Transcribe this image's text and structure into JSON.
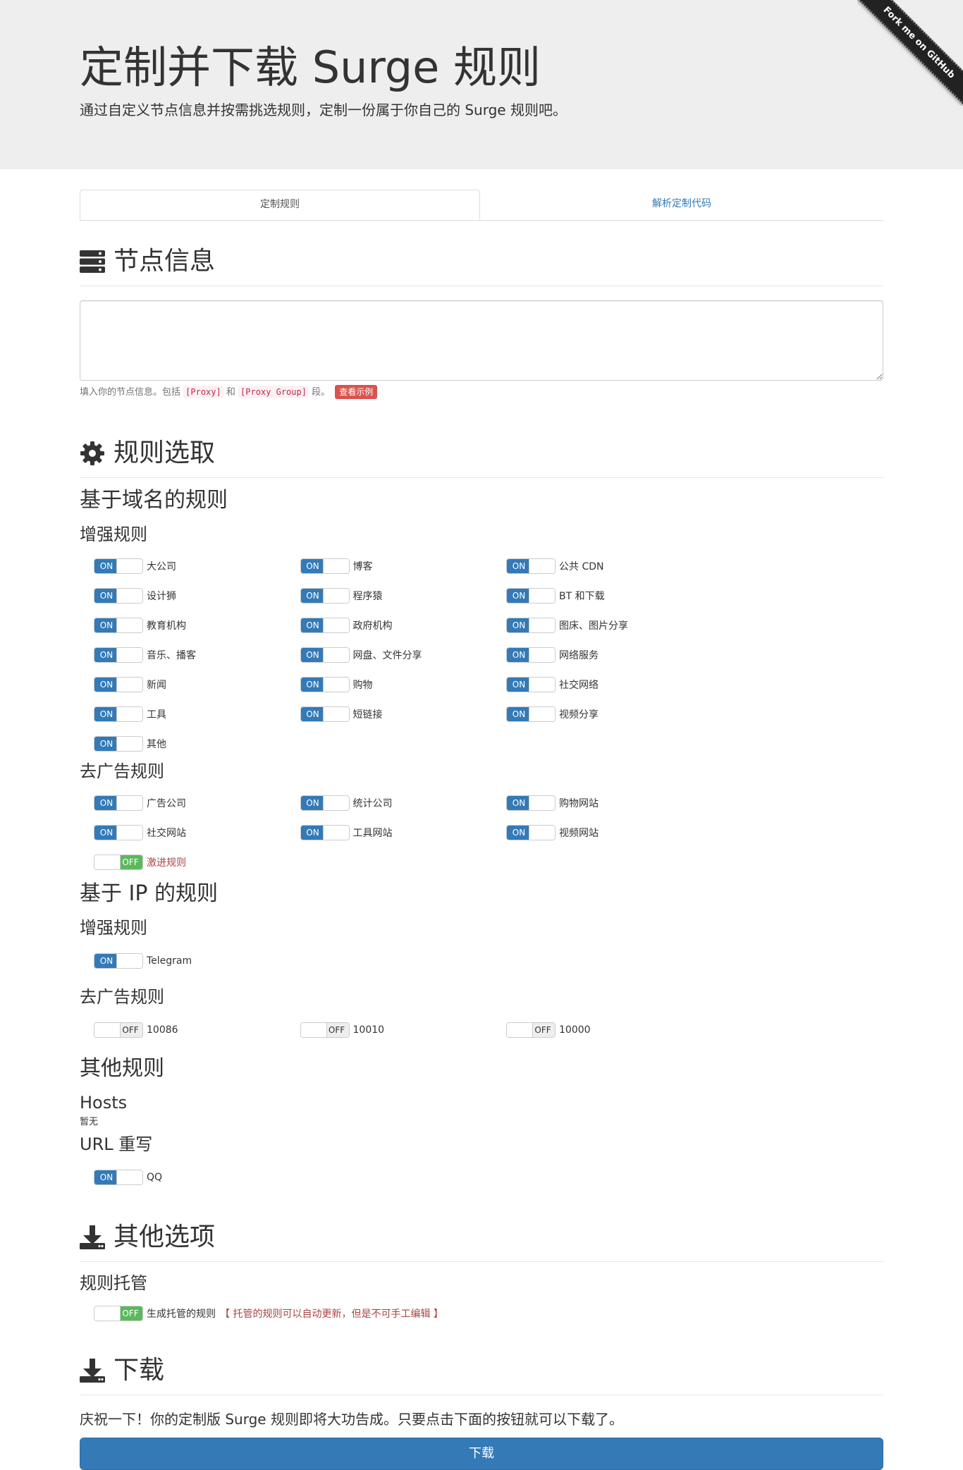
{
  "header": {
    "title": "定制并下载 Surge 规则",
    "subtitle": "通过自定义节点信息并按需挑选规则，定制一份属于你自己的 Surge 规则吧。",
    "ribbon": "Fork me on GitHub"
  },
  "tabs": [
    {
      "label": "定制规则",
      "active": true
    },
    {
      "label": "解析定制代码",
      "active": false
    }
  ],
  "nodes": {
    "title": "节点信息",
    "textarea_value": "",
    "help_prefix": "填入你的节点信息。包括",
    "help_code1": "[Proxy]",
    "help_mid": "和",
    "help_code2": "[Proxy Group]",
    "help_suffix": "段。",
    "example_button": "查看示例"
  },
  "rules": {
    "title": "规则选取",
    "domain_title": "基于域名的规则",
    "enhance_title": "增强规则",
    "adblock_title": "去广告规则",
    "domain_enhance": [
      {
        "state": "ON",
        "label": "大公司"
      },
      {
        "state": "ON",
        "label": "博客"
      },
      {
        "state": "ON",
        "label": "公共 CDN"
      },
      {
        "state": "ON",
        "label": "设计狮"
      },
      {
        "state": "ON",
        "label": "程序猿"
      },
      {
        "state": "ON",
        "label": "BT 和下载"
      },
      {
        "state": "ON",
        "label": "教育机构"
      },
      {
        "state": "ON",
        "label": "政府机构"
      },
      {
        "state": "ON",
        "label": "图床、图片分享"
      },
      {
        "state": "ON",
        "label": "音乐、播客"
      },
      {
        "state": "ON",
        "label": "网盘、文件分享"
      },
      {
        "state": "ON",
        "label": "网络服务"
      },
      {
        "state": "ON",
        "label": "新闻"
      },
      {
        "state": "ON",
        "label": "购物"
      },
      {
        "state": "ON",
        "label": "社交网络"
      },
      {
        "state": "ON",
        "label": "工具"
      },
      {
        "state": "ON",
        "label": "短链接"
      },
      {
        "state": "ON",
        "label": "视频分享"
      },
      {
        "state": "ON",
        "label": "其他"
      }
    ],
    "domain_adblock": [
      {
        "state": "ON",
        "label": "广告公司"
      },
      {
        "state": "ON",
        "label": "统计公司"
      },
      {
        "state": "ON",
        "label": "购物网站"
      },
      {
        "state": "ON",
        "label": "社交网站"
      },
      {
        "state": "ON",
        "label": "工具网站"
      },
      {
        "state": "ON",
        "label": "视频网站"
      },
      {
        "state": "OFF",
        "label": "激进规则",
        "green": true,
        "red": true
      }
    ],
    "ip_title": "基于 IP 的规则",
    "ip_enhance": [
      {
        "state": "ON",
        "label": "Telegram"
      }
    ],
    "ip_adblock": [
      {
        "state": "OFF",
        "label": "10086"
      },
      {
        "state": "OFF",
        "label": "10010"
      },
      {
        "state": "OFF",
        "label": "10000"
      }
    ],
    "other_title": "其他规则",
    "hosts_title": "Hosts",
    "hosts_none": "暂无",
    "url_rewrite_title": "URL 重写",
    "url_rewrite": [
      {
        "state": "ON",
        "label": "QQ"
      }
    ]
  },
  "options": {
    "title": "其他选项",
    "hosting_title": "规则托管",
    "hosting_state": "OFF",
    "hosting_label": "生成托管的规则",
    "hosting_note": "【 托管的规则可以自动更新，但是不可手工编辑 】"
  },
  "download": {
    "title": "下载",
    "text": "庆祝一下！你的定制版 Surge 规则即将大功告成。只要点击下面的按钮就可以下载了。",
    "button": "下载"
  },
  "colors": {
    "primary": "#337ab7",
    "success": "#5cb85c",
    "danger": "#d9534f",
    "jumbotron": "#eeeeee"
  }
}
